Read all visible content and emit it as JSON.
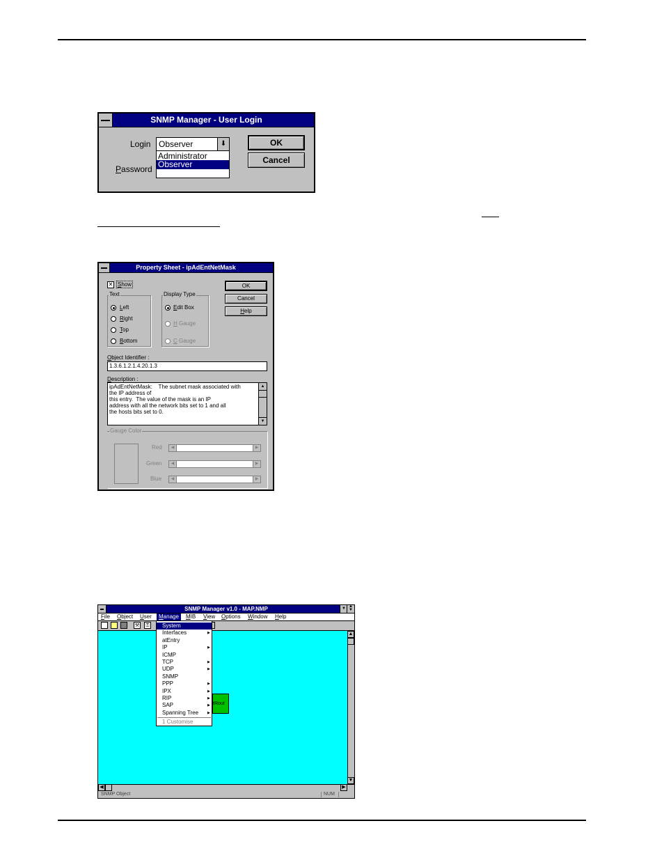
{
  "login_dialog": {
    "title": "SNMP Manager - User Login",
    "login_label": "Login",
    "password_label": "Password",
    "login_value": "Observer",
    "options": [
      "Administrator",
      "Observer"
    ],
    "ok_label": "OK",
    "cancel_label": "Cancel"
  },
  "property_sheet": {
    "title": "Property Sheet - ipAdEntNetMask",
    "show_label": "Show",
    "ok_label": "OK",
    "cancel_label": "Cancel",
    "help_label": "Help",
    "text_group_label": "Text",
    "text_options": [
      "Left",
      "Right",
      "Top",
      "Bottom"
    ],
    "display_group_label": "Display Type",
    "display_options": [
      "Edit Box",
      "H Gauge",
      "C Gauge"
    ],
    "oid_label": "Object Identifier :",
    "oid_value": "1.3.6.1.2.1.4.20.1.3",
    "description_label": "Description :",
    "description_lines": [
      "ipAdEntNetMask:    The subnet mask associated with",
      "the IP address of",
      "this entry.  The value of the mask is an IP",
      "address with all the network bits set to 1 and all",
      "the hosts bits set to 0."
    ],
    "gauge_group_label": "Gauge Color",
    "gauge_colors": [
      "Red",
      "Green",
      "Blue"
    ]
  },
  "snmp_main": {
    "title": "SNMP Manager v1.0 - MAP.NMP",
    "menu": [
      "File",
      "Object",
      "User",
      "Manage",
      "MIB",
      "View",
      "Options",
      "Window",
      "Help"
    ],
    "manage_items": [
      "System",
      "Interfaces",
      "atEntry",
      "IP",
      "ICMP",
      "TCP",
      "UDP",
      "SNMP",
      "PPP",
      "IPX",
      "RIP",
      "SAP",
      "Spanning Tree"
    ],
    "customise_label": "1 Customise",
    "node_label": "tRout",
    "status_left": "SNMP Object",
    "status_num": "NUM",
    "colors": {
      "workspace": "#00ffff",
      "node": "#00c000",
      "titlebar": "#000080"
    }
  }
}
